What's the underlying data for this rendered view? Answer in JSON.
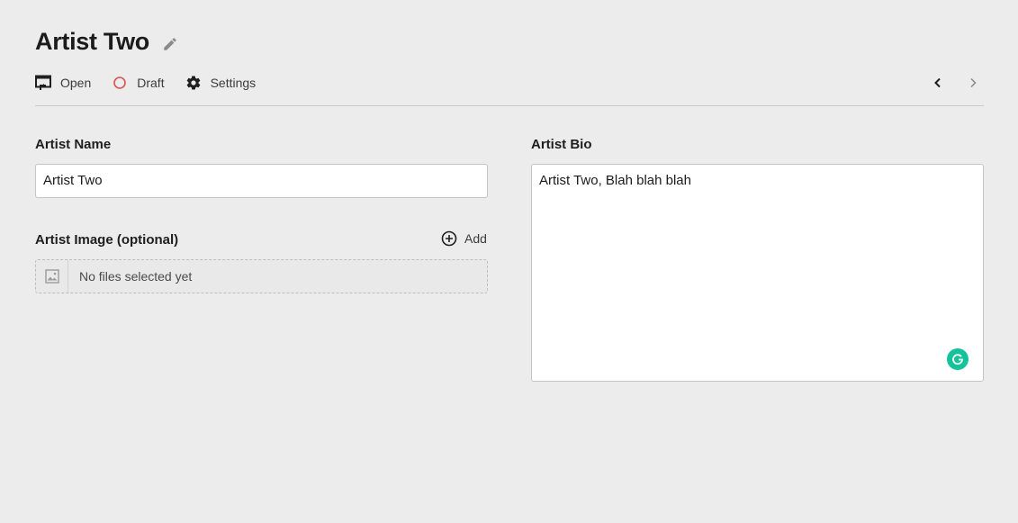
{
  "header": {
    "title": "Artist Two",
    "edit_icon": "pencil-icon"
  },
  "toolbar": {
    "items": [
      {
        "label": "Open",
        "icon": "preview-icon"
      },
      {
        "label": "Draft",
        "icon": "status-circle-icon",
        "status_color": "#d9534f"
      },
      {
        "label": "Settings",
        "icon": "gear-icon"
      }
    ],
    "nav": {
      "prev_icon": "chevron-left-icon",
      "next_icon": "chevron-right-icon"
    }
  },
  "form": {
    "artist_name": {
      "label": "Artist Name",
      "value": "Artist Two"
    },
    "artist_image": {
      "label": "Artist Image (optional)",
      "add_label": "Add",
      "empty_text": "No files selected yet"
    },
    "artist_bio": {
      "label": "Artist Bio",
      "value": "Artist Two, Blah blah blah"
    }
  },
  "colors": {
    "background": "#ececec",
    "grammarly": "#15c39a",
    "draft": "#d9534f"
  }
}
